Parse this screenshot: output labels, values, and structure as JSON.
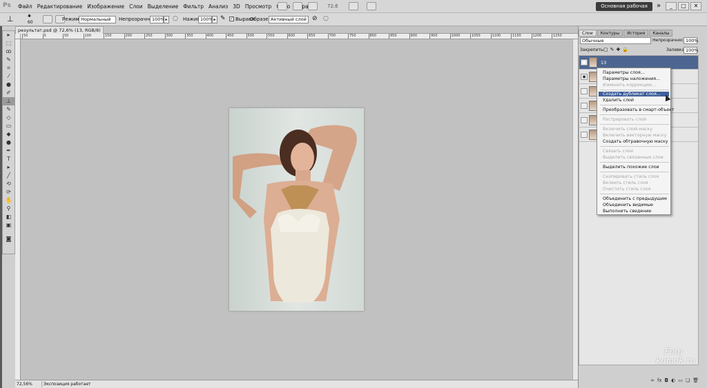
{
  "app": {
    "logo": "Ps",
    "zoom": "72,6"
  },
  "menu": [
    "Файл",
    "Редактирование",
    "Изображение",
    "Слои",
    "Выделение",
    "Фильтр",
    "Анализ",
    "3D",
    "Просмотр",
    "Окно",
    "Справка"
  ],
  "workspace_button": "Основная рабочая среда",
  "workspace_more": "»",
  "window_buttons": [
    "_",
    "□",
    "✕"
  ],
  "options": {
    "brush_size": "60",
    "mode_label": "Режим:",
    "mode_value": "Нормальный",
    "opacity_label": "Непрозрачность:",
    "opacity_value": "100%",
    "pressure_label": "Нажим:",
    "pressure_value": "100%",
    "align_label": "Выравн.",
    "sample_label": "Образец:",
    "sample_value": "Активный слой"
  },
  "document": {
    "tab": "результат.psd @ 72,6% (13, RGB/8) *"
  },
  "ruler_labels": [
    "50",
    "0",
    "50",
    "100",
    "150",
    "200",
    "250",
    "300",
    "350",
    "400",
    "450",
    "500",
    "550",
    "600",
    "650",
    "700",
    "750",
    "800",
    "850",
    "900",
    "950",
    "1000",
    "1050",
    "1100",
    "1150",
    "1200",
    "1250"
  ],
  "status": {
    "zoom": "72,56%",
    "info": "Экспозиция работает только в ..."
  },
  "panel": {
    "tabs": [
      "Слои",
      "Контуры",
      "История",
      "Каналы"
    ],
    "blend_mode": "Обычные",
    "opacity_label": "Непрозрачность:",
    "opacity_value": "100%",
    "lock_label": "Закрепить:",
    "fill_label": "Заливка:",
    "fill_value": "100%",
    "selected_layer": "13"
  },
  "context_menu": {
    "layer_props": "Параметры слоя...",
    "blend_opts": "Параметры наложения...",
    "edit_adj": "Изменить коррекцию...",
    "duplicate": "Создать дубликат слоя...",
    "delete": "Удалить слой",
    "smart": "Преобразовать в смарт-объект",
    "rasterize": "Растрировать слой",
    "enable_mask": "Включить слой-маску",
    "enable_vmask": "Включить векторную маску",
    "clip_mask": "Создать обтравочную маску",
    "link": "Связать слои",
    "select_linked": "Выделить связанные слои",
    "select_similar": "Выделить похожие слои",
    "copy_style": "Скопировать стиль слоя",
    "paste_style": "Вклеить стиль слоя",
    "clear_style": "Очистить стиль слоя",
    "merge_down": "Объединить с предыдущим",
    "merge_visible": "Объединить видимые",
    "flatten": "Выполнить сведение"
  },
  "watermark": {
    "line1": "Foto",
    "line2": "komok.ru"
  }
}
